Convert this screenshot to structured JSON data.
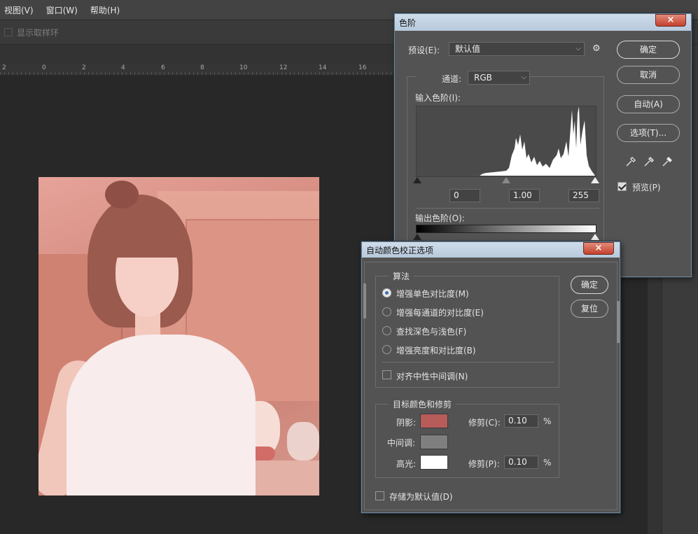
{
  "menubar": {
    "items": [
      "视图(V)",
      "窗口(W)",
      "帮助(H)"
    ]
  },
  "optionsbar": {
    "sample_ring_label": "显示取样环"
  },
  "ruler": {
    "ticks": [
      "2",
      "0",
      "2",
      "4",
      "6",
      "8",
      "10",
      "12",
      "14",
      "16"
    ]
  },
  "levels": {
    "title": "色阶",
    "close": "×",
    "preset_label": "预设(E):",
    "preset_value": "默认值",
    "channel_label": "通道:",
    "channel_value": "RGB",
    "input_label": "输入色阶(I):",
    "input_black": "0",
    "input_gamma": "1.00",
    "input_white": "255",
    "output_label": "输出色阶(O):",
    "buttons": {
      "ok": "确定",
      "cancel": "取消",
      "auto": "自动(A)",
      "options": "选项(T)..."
    },
    "preview_label": "预览(P)",
    "preview_checked": true
  },
  "auto_options": {
    "title": "自动颜色校正选项",
    "close": "×",
    "algorithm_title": "算法",
    "algorithms": [
      "增强单色对比度(M)",
      "增强每通道的对比度(E)",
      "查找深色与浅色(F)",
      "增强亮度和对比度(B)"
    ],
    "selected_algorithm": 0,
    "snap_neutral_label": "对齐中性中间调(N)",
    "target_title": "目标颜色和修剪",
    "shadows_label": "阴影:",
    "midtones_label": "中间调:",
    "highlights_label": "高光:",
    "clip_shadow_label": "修剪(C):",
    "clip_shadow_value": "0.10",
    "clip_highlight_label": "修剪(P):",
    "clip_highlight_value": "0.10",
    "percent": "%",
    "save_default_label": "存储为默认值(D)",
    "buttons": {
      "ok": "确定",
      "reset": "复位"
    },
    "colors": {
      "shadow": "#b85c5a",
      "midtone": "#7f7f7f",
      "highlight": "#ffffff"
    }
  }
}
